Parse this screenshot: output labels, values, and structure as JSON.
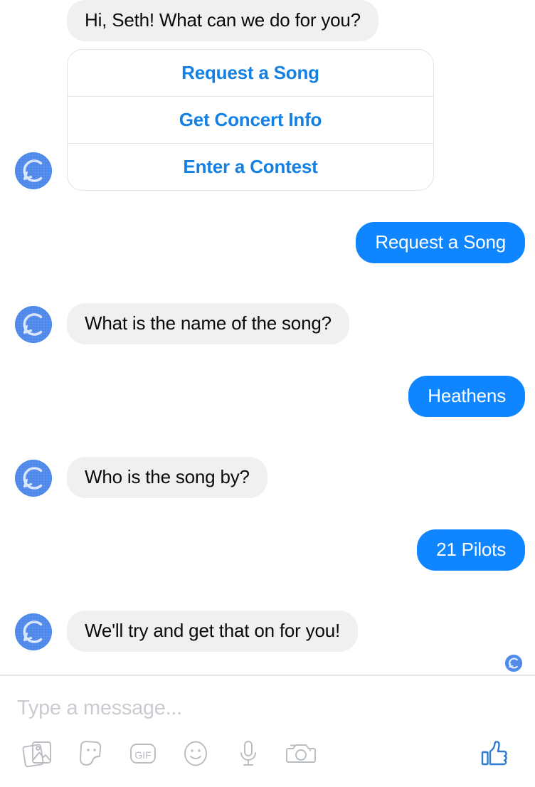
{
  "colors": {
    "outgoing_bubble": "#0f86ff",
    "incoming_bubble": "#f1f0f0",
    "link_blue": "#1380e4",
    "avatar_blue": "#4d88e8",
    "placeholder_gray": "#c9ccd1",
    "icon_gray": "#b5b9bd",
    "like_blue": "#2f7dd1"
  },
  "conversation": {
    "messages": [
      {
        "id": "m1",
        "from": "bot",
        "text": "Hi, Seth! What can we do for you?"
      },
      {
        "id": "m2",
        "from": "user",
        "text": "Request a Song"
      },
      {
        "id": "m3",
        "from": "bot",
        "text": "What is the name of the song?"
      },
      {
        "id": "m4",
        "from": "user",
        "text": "Heathens"
      },
      {
        "id": "m5",
        "from": "bot",
        "text": "Who is the song by?"
      },
      {
        "id": "m6",
        "from": "user",
        "text": "21 Pilots"
      },
      {
        "id": "m7",
        "from": "bot",
        "text": "We'll try and get that on for you!"
      }
    ],
    "quick_replies": [
      {
        "id": "qr1",
        "label": "Request a Song"
      },
      {
        "id": "qr2",
        "label": "Get Concert Info"
      },
      {
        "id": "qr3",
        "label": "Enter a Contest"
      }
    ],
    "avatar_icon": "chat-bubble-c-logo",
    "seen_indicator_icon": "seen-avatar-icon"
  },
  "composer": {
    "placeholder": "Type a message...",
    "value": "",
    "tools": [
      {
        "id": "t1",
        "icon": "photo-gallery-icon"
      },
      {
        "id": "t2",
        "icon": "sticker-icon"
      },
      {
        "id": "t3",
        "icon": "gif-icon",
        "label": "GIF"
      },
      {
        "id": "t4",
        "icon": "emoji-smiley-icon"
      },
      {
        "id": "t5",
        "icon": "microphone-icon"
      },
      {
        "id": "t6",
        "icon": "camera-icon"
      }
    ],
    "like_icon": "thumbs-up-icon"
  }
}
